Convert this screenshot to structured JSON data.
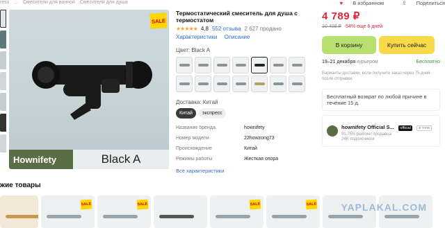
{
  "breadcrumbs": [
    "ress",
    "...",
    "Смесители для ванной",
    "Смесители для душа"
  ],
  "top_actions": {
    "favorite": "В избранном",
    "share": "Поделиться"
  },
  "gallery": {
    "sale_badge": "SALE",
    "brand_logo": "Hownifety",
    "color_name": "Black A"
  },
  "product": {
    "title": "Термостатический смеситель для душа с термостатом",
    "rating": "4,8",
    "stars": "★★★★★",
    "reviews": "552 отзыва",
    "sold": "2 627 продано",
    "tabs": [
      "Характеристики",
      "Описание"
    ],
    "color_label": "Цвет: Black A",
    "delivery_label": "Доставка: Китай",
    "delivery_options": [
      "Китай",
      "экспресс"
    ],
    "specs": [
      {
        "k": "Название бренда",
        "v": "hownifety"
      },
      {
        "k": "Номер модели",
        "v": "22howzong73"
      },
      {
        "k": "Происхождение",
        "v": "Китай"
      },
      {
        "k": "Режимы работы",
        "v": "Жесткая опора"
      }
    ],
    "all_specs": "Все характеристики"
  },
  "buy": {
    "price": "4 789 ₽",
    "old_price": "10 408 ₽",
    "discount": "-54% еще 6 дней",
    "cart_button": "В корзину",
    "buy_now_button": "Купить сейчас",
    "delivery_date": "19–21 декабря",
    "delivery_by": "курьером",
    "delivery_price": "Бесплатно",
    "note": "Варианты доставки, если получите заказ через 75 дней после отправки.",
    "return_text": "Бесплатный возврат по любой причине в течение 15 д.",
    "store": {
      "name": "hownifety Official S...",
      "badge": "official",
      "badge2": "в топе",
      "rating_line": "91,75% рейтинг продавца",
      "subscribers": "24K подписчиков"
    }
  },
  "similar_title": "жие товары",
  "watermark": "YAPLAKAL.COM",
  "swatches": [
    "light",
    "light",
    "light",
    "light",
    "dark",
    "light",
    "light",
    "light",
    "light",
    "light",
    "light",
    "gold",
    "light",
    "light"
  ]
}
